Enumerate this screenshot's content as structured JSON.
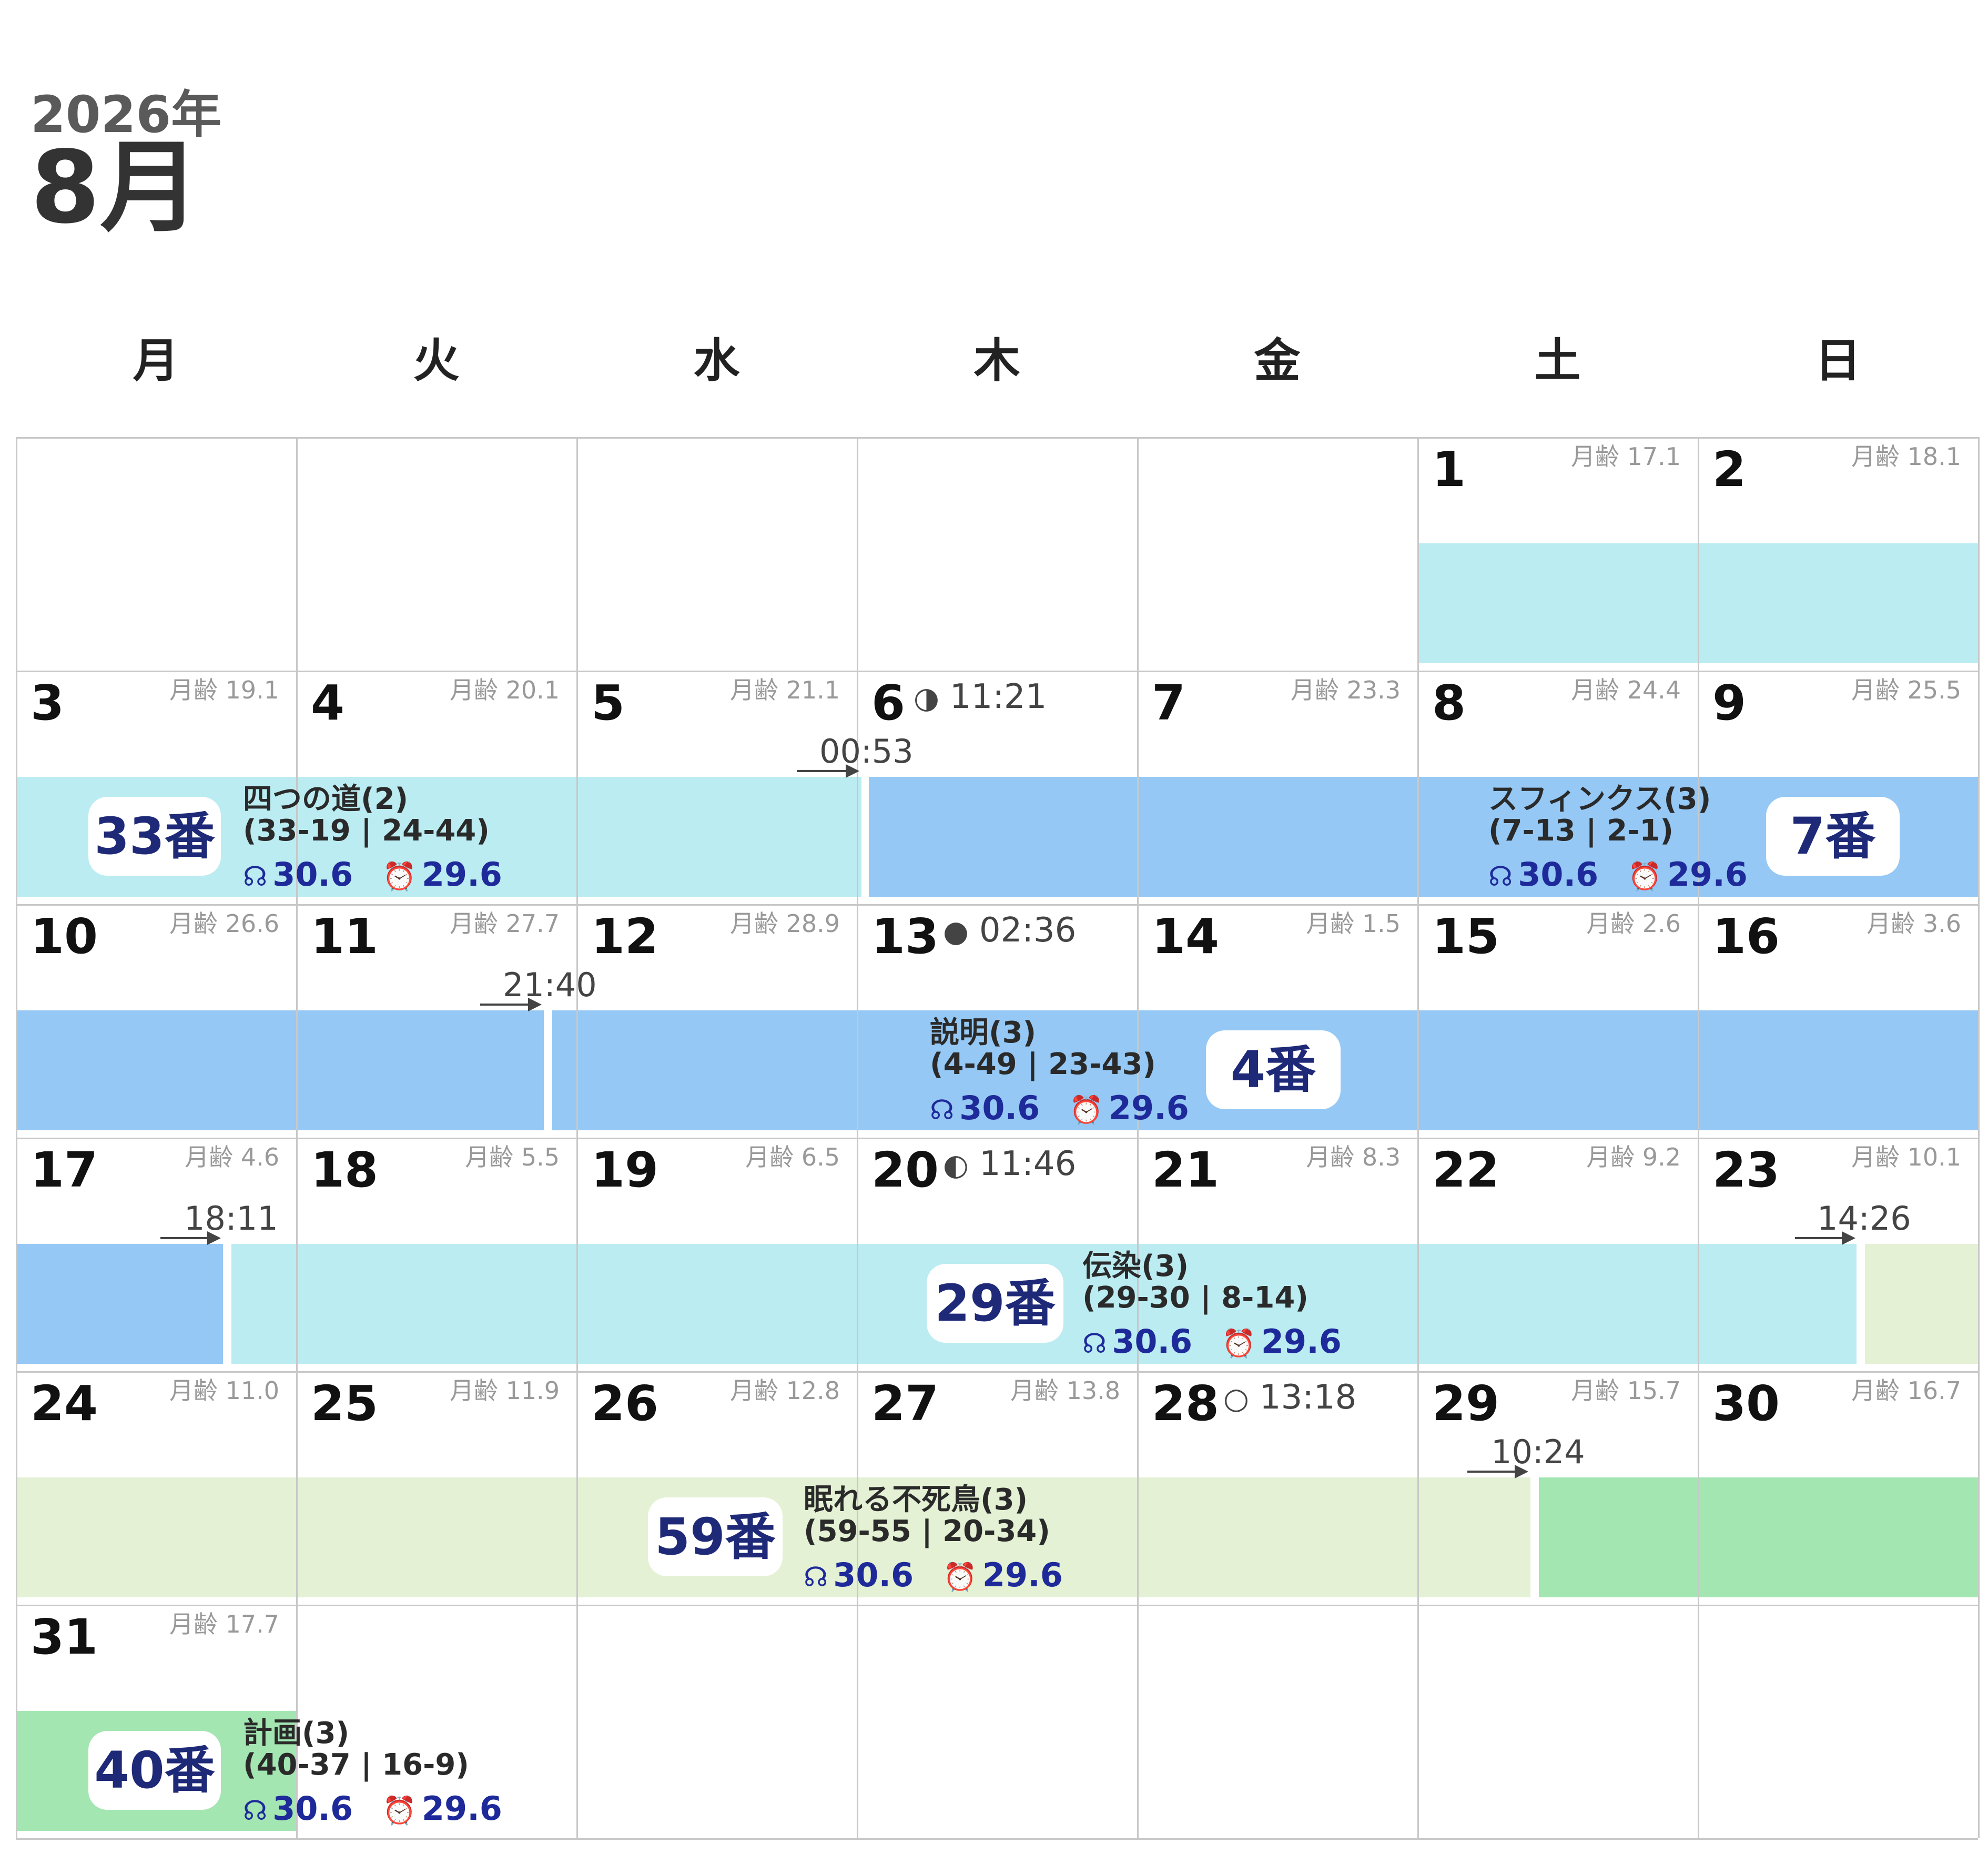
{
  "header": {
    "year": "2026年",
    "month": "8月"
  },
  "weekdays": [
    "月",
    "火",
    "水",
    "木",
    "金",
    "土",
    "日"
  ],
  "moon_label": "月齢",
  "days": [
    {
      "d": "1",
      "age": "17.1"
    },
    {
      "d": "2",
      "age": "18.1"
    },
    {
      "d": "3",
      "age": "19.1"
    },
    {
      "d": "4",
      "age": "20.1"
    },
    {
      "d": "5",
      "age": "21.1"
    },
    {
      "d": "6",
      "phase": "◑",
      "phase_time": "11:21"
    },
    {
      "d": "7",
      "age": "23.3"
    },
    {
      "d": "8",
      "age": "24.4"
    },
    {
      "d": "9",
      "age": "25.5"
    },
    {
      "d": "10",
      "age": "26.6"
    },
    {
      "d": "11",
      "age": "27.7"
    },
    {
      "d": "12",
      "age": "28.9"
    },
    {
      "d": "13",
      "phase": "●",
      "phase_time": "02:36"
    },
    {
      "d": "14",
      "age": "1.5"
    },
    {
      "d": "15",
      "age": "2.6"
    },
    {
      "d": "16",
      "age": "3.6"
    },
    {
      "d": "17",
      "age": "4.6"
    },
    {
      "d": "18",
      "age": "5.5"
    },
    {
      "d": "19",
      "age": "6.5"
    },
    {
      "d": "20",
      "phase": "◐",
      "phase_time": "11:46"
    },
    {
      "d": "21",
      "age": "8.3"
    },
    {
      "d": "22",
      "age": "9.2"
    },
    {
      "d": "23",
      "age": "10.1"
    },
    {
      "d": "24",
      "age": "11.0"
    },
    {
      "d": "25",
      "age": "11.9"
    },
    {
      "d": "26",
      "age": "12.8"
    },
    {
      "d": "27",
      "age": "13.8"
    },
    {
      "d": "28",
      "phase": "○",
      "phase_time": "13:18"
    },
    {
      "d": "29",
      "age": "15.7"
    },
    {
      "d": "30",
      "age": "16.7"
    },
    {
      "d": "31",
      "age": "17.7"
    }
  ],
  "transitions": [
    "00:53",
    "21:40",
    "18:11",
    "14:26",
    "10:24"
  ],
  "events": [
    {
      "number": "33番",
      "name": "四つの道(2)",
      "code": "(33-19 | 24-44)",
      "stat1": "30.6",
      "stat2": "29.6",
      "color": "#bbecf2"
    },
    {
      "number": "7番",
      "name": "スフィンクス(3)",
      "code": "(7-13 | 2-1)",
      "stat1": "30.6",
      "stat2": "29.6",
      "color": "#95c8f4"
    },
    {
      "number": "4番",
      "name": "説明(3)",
      "code": "(4-49 | 23-43)",
      "stat1": "30.6",
      "stat2": "29.6",
      "color": "#95c8f4"
    },
    {
      "number": "29番",
      "name": "伝染(3)",
      "code": "(29-30 | 8-14)",
      "stat1": "30.6",
      "stat2": "29.6",
      "color": "#bbecf2"
    },
    {
      "number": "59番",
      "name": "眠れる不死鳥(3)",
      "code": "(59-55 | 20-34)",
      "stat1": "30.6",
      "stat2": "29.6",
      "color": "#e4f1d4"
    },
    {
      "number": "40番",
      "name": "計画(3)",
      "code": "(40-37 | 16-9)",
      "stat1": "30.6",
      "stat2": "29.6",
      "color": "#a3e6b2"
    }
  ],
  "icons": {
    "stat1": "headphones-icon",
    "stat2": "alarm-clock-icon"
  }
}
